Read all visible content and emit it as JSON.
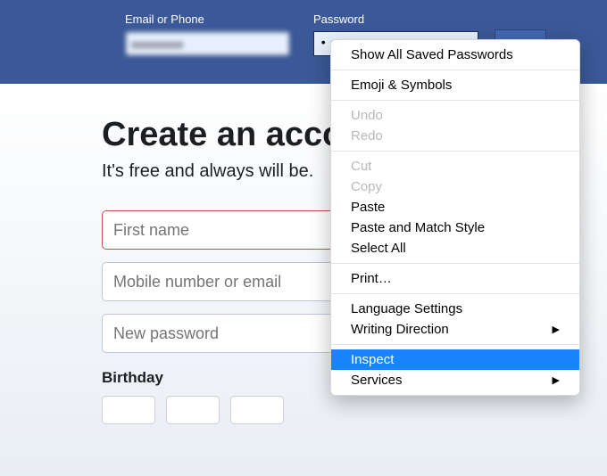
{
  "topbar": {
    "email_label": "Email or Phone",
    "password_label": "Password",
    "email_value": "xxxxxxxxx",
    "password_masked": "••"
  },
  "signup": {
    "heading": "Create an account",
    "subheading": "It's free and always will be.",
    "first_name_placeholder": "First name",
    "mobile_placeholder": "Mobile number or email",
    "new_password_placeholder": "New password",
    "birthday_label": "Birthday",
    "error_badge": "!"
  },
  "context_menu": {
    "items": [
      {
        "label": "Show All Saved Passwords",
        "enabled": true,
        "submenu": false
      },
      {
        "sep": true
      },
      {
        "label": "Emoji & Symbols",
        "enabled": true,
        "submenu": false
      },
      {
        "sep": true
      },
      {
        "label": "Undo",
        "enabled": false,
        "submenu": false
      },
      {
        "label": "Redo",
        "enabled": false,
        "submenu": false
      },
      {
        "sep": true
      },
      {
        "label": "Cut",
        "enabled": false,
        "submenu": false
      },
      {
        "label": "Copy",
        "enabled": false,
        "submenu": false
      },
      {
        "label": "Paste",
        "enabled": true,
        "submenu": false
      },
      {
        "label": "Paste and Match Style",
        "enabled": true,
        "submenu": false
      },
      {
        "label": "Select All",
        "enabled": true,
        "submenu": false
      },
      {
        "sep": true
      },
      {
        "label": "Print…",
        "enabled": true,
        "submenu": false
      },
      {
        "sep": true
      },
      {
        "label": "Language Settings",
        "enabled": true,
        "submenu": false
      },
      {
        "label": "Writing Direction",
        "enabled": true,
        "submenu": true
      },
      {
        "sep": true
      },
      {
        "label": "Inspect",
        "enabled": true,
        "submenu": false,
        "highlight": true
      },
      {
        "label": "Services",
        "enabled": true,
        "submenu": true
      }
    ]
  }
}
